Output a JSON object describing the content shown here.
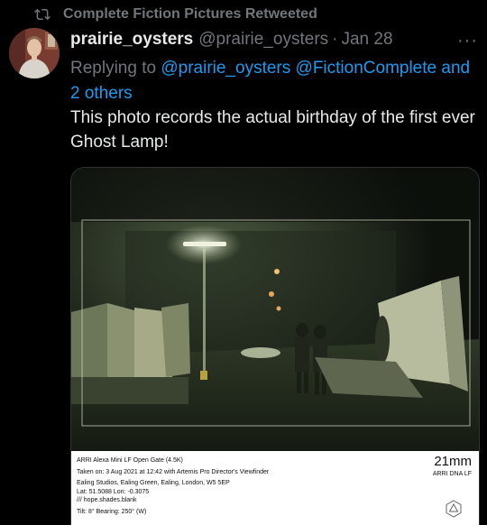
{
  "retweet": {
    "label": "Complete Fiction Pictures Retweeted"
  },
  "tweet": {
    "display_name": "prairie_oysters",
    "handle": "@prairie_oysters",
    "separator": "·",
    "date": "Jan 28",
    "more": "···",
    "replying_prefix": "Replying to ",
    "replying_to": [
      "@prairie_oysters",
      "@FictionComplete"
    ],
    "replying_suffix": "and 2 others",
    "text": "This photo records the actual birthday of the first ever Ghost Lamp!"
  },
  "media": {
    "caption": {
      "camera": "ARRI Alexa Mini LF Open Gate (4.5K)",
      "taken": "Taken on: 3 Aug 2021 at 12:42 with Artemis Pro Director's Viewfinder",
      "location": "Ealing Studios, Ealing Green, Ealing, London, W5 5EP",
      "coords": "Lat: 51.5088  Lon: -0.3075",
      "w3w": "/// hope.shades.blank",
      "tilt": "Tilt: 8°  Bearing: 250° (W)",
      "focal": "21mm",
      "lens": "ARRI DNA LF"
    }
  }
}
